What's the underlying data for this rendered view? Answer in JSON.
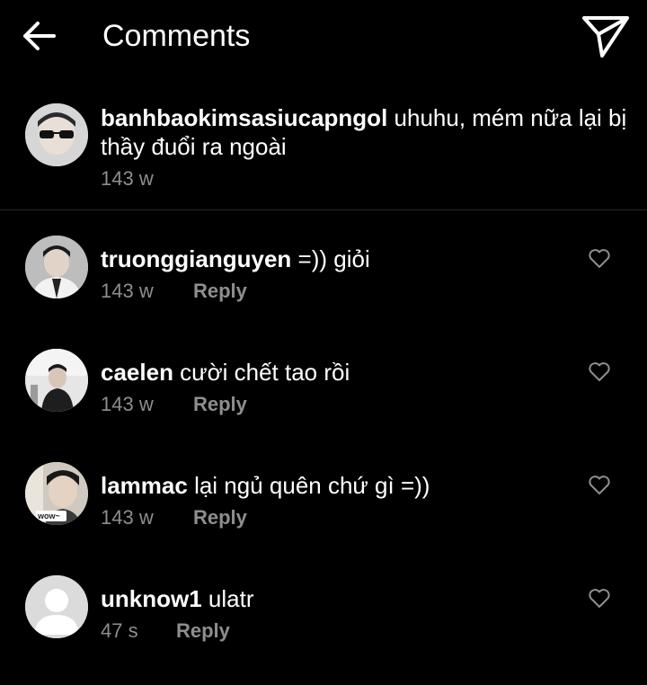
{
  "header": {
    "title": "Comments",
    "back_icon": "arrow-left-icon",
    "send_icon": "paper-plane-icon"
  },
  "caption": {
    "username": "banhbaokimsasiucapngol",
    "text": " uhuhu, mém nữa lại bị thầy đuổi ra ngoài",
    "time": "143 w"
  },
  "comments": [
    {
      "username": "truonggianguyen",
      "text": " =)) giỏi",
      "time": "143 w",
      "reply": "Reply",
      "icon": "heart-icon"
    },
    {
      "username": "caelen",
      "text": " cười chết tao rồi",
      "time": "143 w",
      "reply": "Reply",
      "icon": "heart-icon"
    },
    {
      "username": "lammac",
      "text": " lại ngủ quên chứ gì =))",
      "time": "143 w",
      "reply": "Reply",
      "icon": "heart-icon",
      "avatar_badge": "wow~"
    },
    {
      "username": "unknow1",
      "text": " ulatr",
      "time": "47 s",
      "reply": "Reply",
      "icon": "heart-icon"
    }
  ],
  "colors": {
    "background": "#000000",
    "text": "#ffffff",
    "muted": "#8e8e8e",
    "divider": "#262626"
  }
}
